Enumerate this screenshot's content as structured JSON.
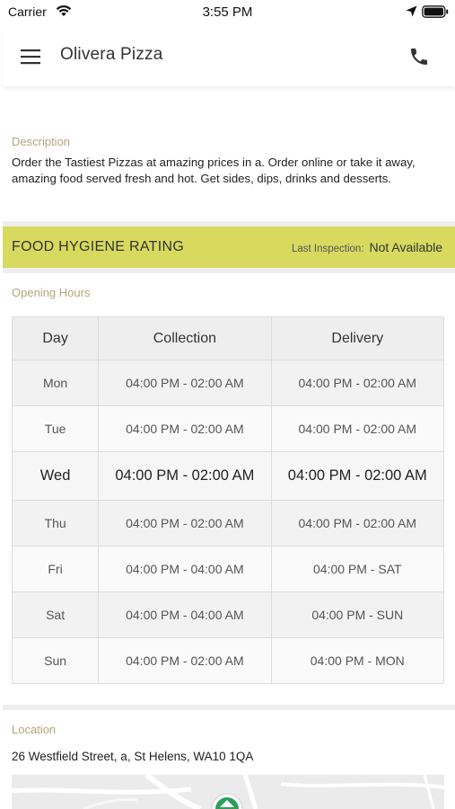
{
  "status_bar": {
    "carrier": "Carrier",
    "time": "3:55 PM"
  },
  "header": {
    "title": "Olivera Pizza"
  },
  "description": {
    "label": "Description",
    "text": "Order the Tastiest Pizzas at amazing prices in a. Order online or take it away, amazing food served fresh and hot. Get sides, dips, drinks and desserts."
  },
  "hygiene": {
    "title": "FOOD HYGIENE RATING",
    "inspection_label": "Last Inspection:",
    "inspection_value": "Not Available",
    "color": "#d7da5e"
  },
  "opening_hours": {
    "label": "Opening Hours",
    "headers": {
      "day": "Day",
      "collection": "Collection",
      "delivery": "Delivery"
    },
    "rows": [
      {
        "day": "Mon",
        "collection": "04:00 PM - 02:00 AM",
        "delivery": "04:00 PM - 02:00 AM"
      },
      {
        "day": "Tue",
        "collection": "04:00 PM - 02:00 AM",
        "delivery": "04:00 PM - 02:00 AM"
      },
      {
        "day": "Wed",
        "collection": "04:00 PM - 02:00 AM",
        "delivery": "04:00 PM - 02:00 AM"
      },
      {
        "day": "Thu",
        "collection": "04:00 PM - 02:00 AM",
        "delivery": "04:00 PM - 02:00 AM"
      },
      {
        "day": "Fri",
        "collection": "04:00 PM - 04:00 AM",
        "delivery": "04:00 PM - SAT"
      },
      {
        "day": "Sat",
        "collection": "04:00 PM - 04:00 AM",
        "delivery": "04:00 PM - SUN"
      },
      {
        "day": "Sun",
        "collection": "04:00 PM - 02:00 AM",
        "delivery": "04:00 PM - MON"
      }
    ]
  },
  "location": {
    "label": "Location",
    "address": "26 Westfield Street, a, St Helens, WA10 1QA"
  },
  "icons": {
    "menu": "hamburger-menu-icon",
    "phone": "phone-icon",
    "wifi": "wifi-icon",
    "battery": "battery-icon",
    "location": "location-arrow-icon",
    "map_pin": "map-pin-icon"
  },
  "colors": {
    "section_label": "#b3a57a",
    "map_pin": "#2e9e5b"
  }
}
